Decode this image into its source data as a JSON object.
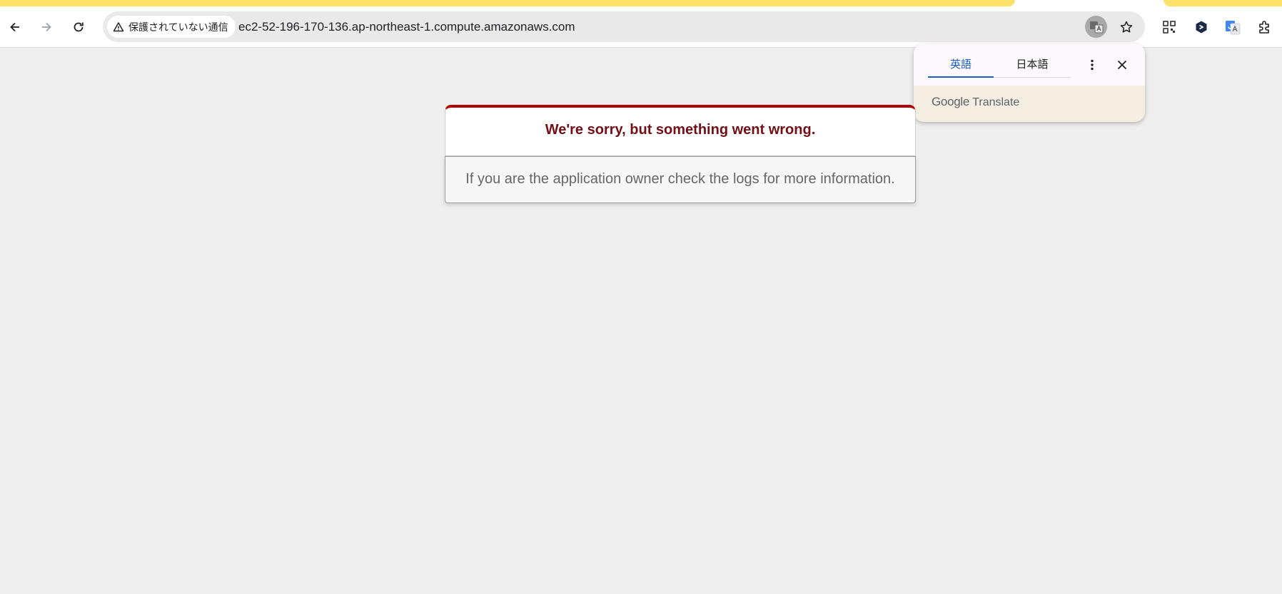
{
  "browser": {
    "security_chip": "保護されていない通信",
    "url": "ec2-52-196-170-136.ap-northeast-1.compute.amazonaws.com",
    "icons": [
      "back-icon",
      "forward-icon",
      "reload-icon",
      "warning-icon",
      "translate-icon",
      "star-icon",
      "qr-code-icon",
      "extension-hex-icon",
      "google-translate-icon",
      "puzzle-icon"
    ]
  },
  "translate_popup": {
    "tab_source": "英語",
    "tab_target": "日本語",
    "brand_google": "Google",
    "brand_translate": "Translate",
    "accent_color": "#1a5fc9"
  },
  "error": {
    "title": "We're sorry, but something went wrong.",
    "message": "If you are the application owner check the logs for more information.",
    "title_color": "#730e15",
    "border_color": "#b00100"
  }
}
